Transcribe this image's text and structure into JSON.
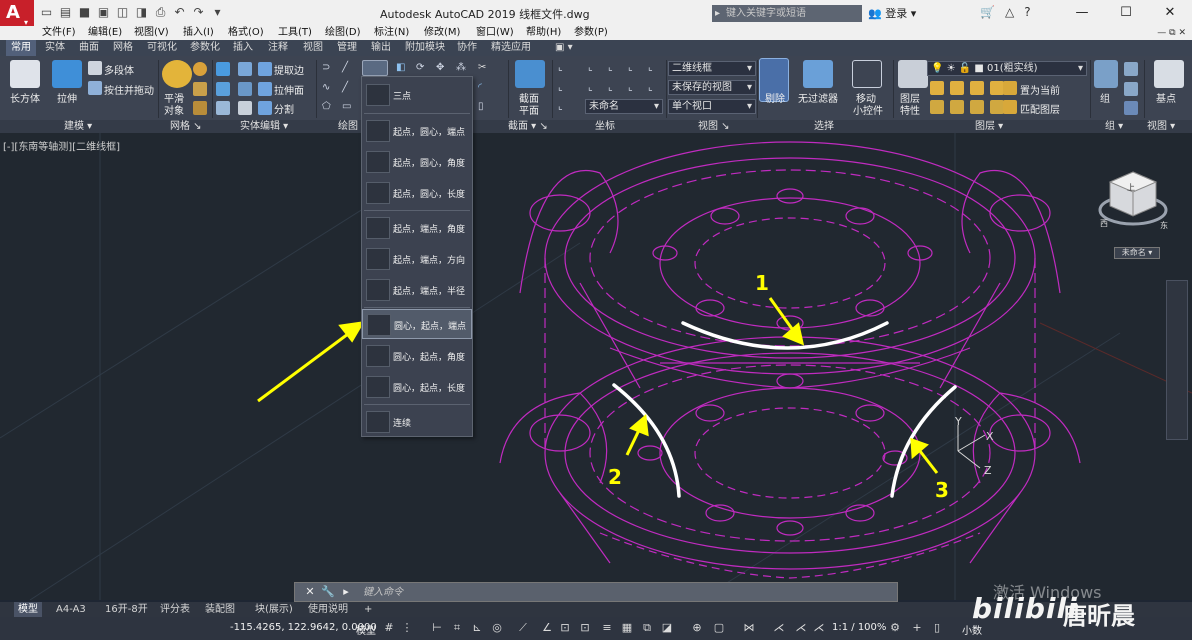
{
  "app": {
    "logo_letter": "A",
    "title": "Autodesk AutoCAD 2019    线框文件.dwg",
    "search_placeholder": "键入关键字或短语",
    "login": "登录"
  },
  "menu": [
    "文件(F)",
    "编辑(E)",
    "视图(V)",
    "插入(I)",
    "格式(O)",
    "工具(T)",
    "绘图(D)",
    "标注(N)",
    "修改(M)",
    "窗口(W)",
    "帮助(H)",
    "参数(P)"
  ],
  "ribbon_tabs": [
    "常用",
    "实体",
    "曲面",
    "网格",
    "可视化",
    "参数化",
    "插入",
    "注释",
    "视图",
    "管理",
    "输出",
    "附加模块",
    "协作",
    "精选应用"
  ],
  "ribbon": {
    "box": "长方体",
    "extrude": "拉伸",
    "polysolid": "多段体",
    "presspull": "按住并拖动",
    "smooth_object": [
      "平滑",
      "对象"
    ],
    "extract_edges": "提取边",
    "extrude_faces": "拉伸面",
    "separate": "分割",
    "section_plane": [
      "截面",
      "平面"
    ],
    "visual_style": "二维线框",
    "saved_view": "未保存的视图",
    "unnamed": "未命名",
    "single_viewport": "单个视口",
    "cull": "剔除",
    "no_filter": "无过滤器",
    "move_gizmo": [
      "移动",
      "小控件"
    ],
    "layer_properties": [
      "图层",
      "特性"
    ],
    "layer_name": "01(粗实线)",
    "set_current": "置为当前",
    "match_layer": "匹配图层",
    "group": "组",
    "base_point": "基点"
  },
  "panel_titles": {
    "modeling": "建模",
    "mesh": "网格",
    "solid_edit": "实体编辑",
    "draw": "绘图",
    "section": "截面",
    "coordinates": "坐标",
    "view": "视图",
    "selection": "选择",
    "layers": "图层",
    "groups": "组",
    "view2": "视图"
  },
  "arc_menu": [
    "三点",
    "起点，圆心，端点",
    "起点，圆心，角度",
    "起点，圆心，长度",
    "起点，端点，角度",
    "起点，端点，方向",
    "起点，端点，半径",
    "圆心，起点，端点",
    "圆心，起点，角度",
    "圆心，起点，长度",
    "连续"
  ],
  "viewport_label": "[-][东南等轴测][二维线框]",
  "annotations": [
    "1",
    "2",
    "3"
  ],
  "ucs": {
    "x": "X",
    "y": "Y",
    "z": "Z"
  },
  "navcube": {
    "label": "未命名",
    "face_top": "上",
    "compass_west": "西",
    "compass_east": "东",
    "compass_south": "南"
  },
  "command_placeholder": "键入命令",
  "layout_tabs": [
    "模型",
    "A4-A3",
    "16开-8开",
    "评分表",
    "装配图",
    "块(展示)",
    "使用说明"
  ],
  "status": {
    "coords": "-115.4265, 122.9642, 0.0000",
    "model": "模型",
    "scale": "1:1 / 100%",
    "decimal": "小数"
  },
  "watermark": {
    "activate": "激活 Windows",
    "brand": "bilibili",
    "author": "唐昕晨"
  },
  "colors": {
    "accent_yellow": "#ffff00",
    "drawing_magenta": "#c02bc0",
    "canvas_bg": "#212830"
  }
}
